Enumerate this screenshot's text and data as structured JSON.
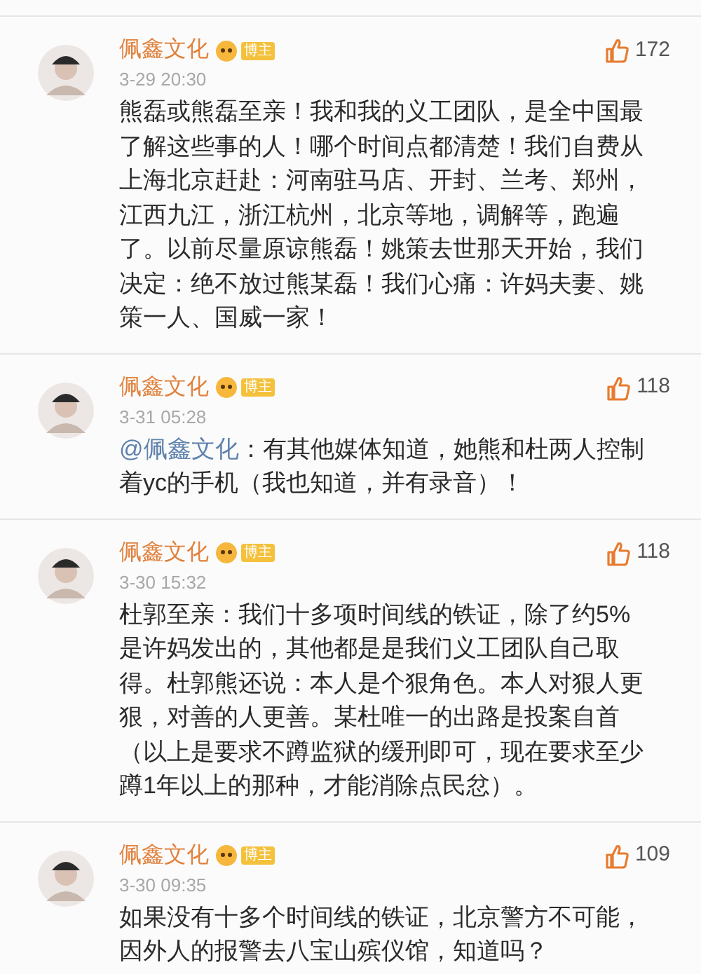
{
  "comments": [
    {
      "author": "佩鑫文化",
      "badge": "博主",
      "time": "3-29 20:30",
      "likes": "172",
      "text": "熊磊或熊磊至亲！我和我的义工团队，是全中国最了解这些事的人！哪个时间点都清楚！我们自费从上海北京赶赴：河南驻马店、开封、兰考、郑州，江西九江，浙江杭州，北京等地，调解等，跑遍了。以前尽量原谅熊磊！姚策去世那天开始，我们决定：绝不放过熊某磊！我们心痛：许妈夫妻、姚策一人、国威一家！"
    },
    {
      "author": "佩鑫文化",
      "badge": "博主",
      "time": "3-31 05:28",
      "likes": "118",
      "mention": "@佩鑫文化",
      "text": "：有其他媒体知道，她熊和杜两人控制着yc的手机（我也知道，并有录音）！"
    },
    {
      "author": "佩鑫文化",
      "badge": "博主",
      "time": "3-30 15:32",
      "likes": "118",
      "text": "杜郭至亲：我们十多项时间线的铁证，除了约5%是许妈发出的，其他都是是我们义工团队自己取得。杜郭熊还说：本人是个狠角色。本人对狠人更狠，对善的人更善。某杜唯一的出路是投案自首（以上是要求不蹲监狱的缓刑即可，现在要求至少蹲1年以上的那种，才能消除点民忿）。"
    },
    {
      "author": "佩鑫文化",
      "badge": "博主",
      "time": "3-30 09:35",
      "likes": "109",
      "text": "如果没有十多个时间线的铁证，北京警方不可能，因外人的报警去八宝山殡仪馆，知道吗？"
    }
  ]
}
